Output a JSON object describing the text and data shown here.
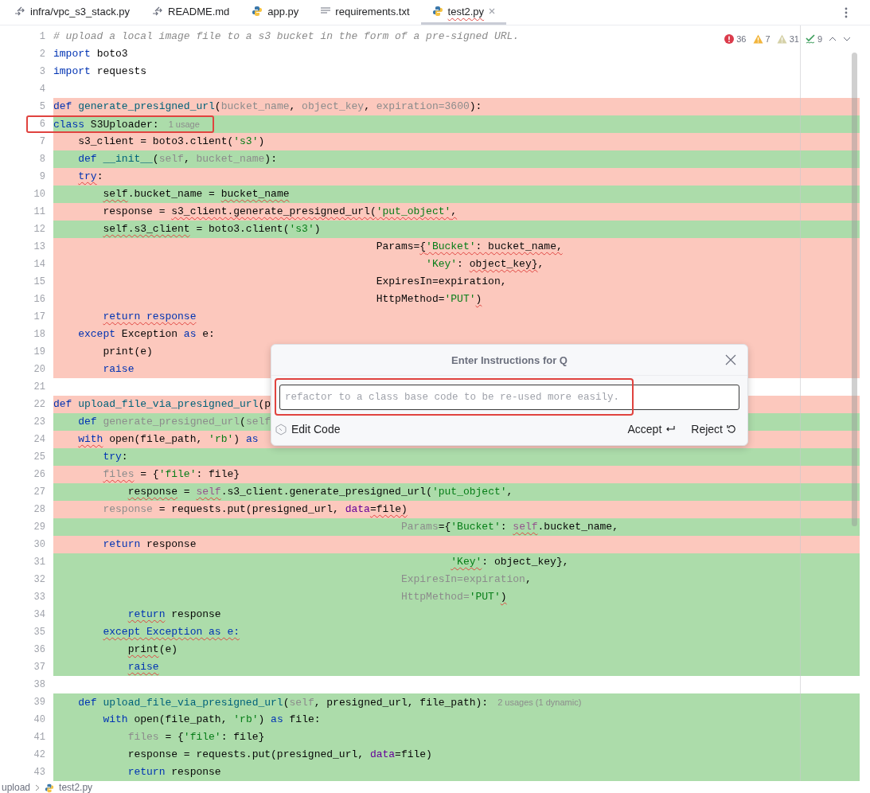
{
  "tabs": [
    {
      "label": "infra/vpc_s3_stack.py",
      "kind": "diff",
      "selected": false
    },
    {
      "label": "README.md",
      "kind": "diff",
      "selected": false
    },
    {
      "label": "app.py",
      "kind": "python",
      "selected": false
    },
    {
      "label": "requirements.txt",
      "kind": "text",
      "selected": false
    },
    {
      "label": "test2.py",
      "kind": "python",
      "selected": true
    }
  ],
  "inspections": [
    {
      "kind": "error",
      "count": "36"
    },
    {
      "kind": "warning",
      "count": "7"
    },
    {
      "kind": "weak",
      "count": "31"
    },
    {
      "kind": "typo",
      "count": "9"
    }
  ],
  "lines": [
    {
      "number": "1",
      "kind": "plain",
      "highlighted": false,
      "code": [
        {
          "kind": "comment",
          "text": "# upload a local image file to a s3 bucket in the form of a pre-signed URL."
        }
      ]
    },
    {
      "number": "2",
      "kind": "plain",
      "highlighted": false,
      "code": [
        {
          "kind": "keyword",
          "text": "import"
        },
        {
          "text": " boto3"
        }
      ]
    },
    {
      "number": "3",
      "kind": "plain",
      "highlighted": false,
      "code": [
        {
          "kind": "keyword",
          "text": "import"
        },
        {
          "text": " requests"
        }
      ]
    },
    {
      "number": "4",
      "kind": "plain",
      "highlighted": false
    },
    {
      "number": "5",
      "kind": "removed",
      "highlighted": false,
      "code": [
        {
          "kind": "keyword",
          "text": "def "
        },
        {
          "kind": "function",
          "text": "generate_presigned_url"
        },
        {
          "text": "("
        },
        {
          "kind": "unused",
          "text": "bucket_name"
        },
        {
          "text": ", "
        },
        {
          "kind": "unused",
          "text": "object_key"
        },
        {
          "text": ", "
        },
        {
          "kind": "unused",
          "text": "expiration=3600"
        },
        {
          "text": "):"
        }
      ]
    },
    {
      "number": "6",
      "kind": "added",
      "highlighted": true,
      "code": [
        {
          "kind": "keyword",
          "text": "class"
        },
        {
          "text": " S3Uploader:"
        },
        {
          "kind": "hint",
          "text": "1 usage"
        }
      ]
    },
    {
      "number": "7",
      "kind": "removed",
      "highlighted": false,
      "code": [
        {
          "text": "    s3_client = boto3.client("
        },
        {
          "kind": "string",
          "text": "'s3'"
        },
        {
          "text": ")"
        }
      ]
    },
    {
      "number": "8",
      "kind": "added",
      "highlighted": false,
      "code": [
        {
          "kind": "keyword",
          "text": "    def "
        },
        {
          "kind": "function",
          "text": "__init__"
        },
        {
          "text": "("
        },
        {
          "kind": "unused",
          "text": "self"
        },
        {
          "text": ", "
        },
        {
          "kind": "unused",
          "text": "bucket_name"
        },
        {
          "text": "):"
        }
      ]
    },
    {
      "number": "9",
      "kind": "removed",
      "highlighted": false,
      "code": [
        {
          "kind": "keyword",
          "text": "    try",
          "squiggle": true
        },
        {
          "text": ":"
        }
      ]
    },
    {
      "number": "10",
      "kind": "added",
      "highlighted": false,
      "code": [
        {
          "text": "        self",
          "squiggle": true
        },
        {
          "text": ".bucket_name = "
        },
        {
          "text": "bucket_name",
          "squiggle": true
        }
      ]
    },
    {
      "number": "11",
      "kind": "removed",
      "highlighted": false,
      "code": [
        {
          "text": "        response = "
        },
        {
          "text": "s3_client.generate_presigned_url(",
          "squiggle": true
        },
        {
          "kind": "string",
          "text": "'put_object'",
          "squiggle": true
        },
        {
          "text": ",",
          "squiggle": true
        }
      ]
    },
    {
      "number": "12",
      "kind": "added",
      "highlighted": false,
      "code": [
        {
          "text": "        self.s3_client",
          "squiggle": true
        },
        {
          "text": " = boto3.client("
        },
        {
          "kind": "string",
          "text": "'s3'"
        },
        {
          "text": ")"
        }
      ]
    },
    {
      "number": "13",
      "kind": "removed",
      "highlighted": false,
      "code": [
        {
          "text": "                                                    Params="
        },
        {
          "text": "{",
          "squiggle": true
        },
        {
          "kind": "string",
          "text": "'Bucket'",
          "squiggle": true
        },
        {
          "text": ": bucket_name,",
          "squiggle": true
        }
      ]
    },
    {
      "number": "14",
      "kind": "removed",
      "highlighted": false,
      "code": [
        {
          "kind": "string",
          "text": "                                                            'Key'"
        },
        {
          "text": ": "
        },
        {
          "text": "object_key}",
          "squiggle": true
        },
        {
          "text": ","
        }
      ]
    },
    {
      "number": "15",
      "kind": "removed",
      "highlighted": false,
      "code": [
        {
          "text": "                                                    ExpiresIn=expiration,"
        }
      ]
    },
    {
      "number": "16",
      "kind": "removed",
      "highlighted": false,
      "code": [
        {
          "text": "                                                    HttpMethod="
        },
        {
          "kind": "string",
          "text": "'PUT'"
        },
        {
          "text": ")",
          "squiggle": true
        }
      ]
    },
    {
      "number": "17",
      "kind": "removed",
      "highlighted": false,
      "code": [
        {
          "kind": "keyword",
          "text": "        return response",
          "squiggle": true
        }
      ]
    },
    {
      "number": "18",
      "kind": "removed",
      "highlighted": false,
      "code": [
        {
          "kind": "keyword",
          "text": "    except"
        },
        {
          "text": " Exception "
        },
        {
          "kind": "keyword",
          "text": "as"
        },
        {
          "text": " e:"
        }
      ]
    },
    {
      "number": "19",
      "kind": "removed",
      "highlighted": false,
      "code": [
        {
          "text": "        print(e)"
        }
      ]
    },
    {
      "number": "20",
      "kind": "removed",
      "highlighted": false,
      "code": [
        {
          "kind": "keyword",
          "text": "        raise"
        }
      ]
    },
    {
      "number": "21",
      "kind": "plain",
      "highlighted": false
    },
    {
      "number": "22",
      "kind": "removed",
      "highlighted": false,
      "code": [
        {
          "kind": "keyword",
          "text": "def "
        },
        {
          "kind": "function",
          "text": "upload_file_via_presigned_url"
        },
        {
          "text": "(p"
        }
      ]
    },
    {
      "number": "23",
      "kind": "added",
      "highlighted": false,
      "code": [
        {
          "kind": "keyword",
          "text": "    def "
        },
        {
          "kind": "unused",
          "text": "generate_presigned_url"
        },
        {
          "text": "("
        },
        {
          "kind": "unused",
          "text": "self"
        }
      ]
    },
    {
      "number": "24",
      "kind": "removed",
      "highlighted": false,
      "code": [
        {
          "kind": "keyword",
          "text": "    with",
          "squiggle": true
        },
        {
          "text": " open(file_path, "
        },
        {
          "kind": "string",
          "text": "'rb'"
        },
        {
          "text": ") "
        },
        {
          "kind": "keyword",
          "text": "as"
        }
      ]
    },
    {
      "number": "25",
      "kind": "added",
      "highlighted": false,
      "code": [
        {
          "kind": "keyword",
          "text": "        try"
        },
        {
          "text": ":"
        }
      ]
    },
    {
      "number": "26",
      "kind": "removed",
      "highlighted": false,
      "code": [
        {
          "kind": "unused",
          "text": "        files",
          "squiggle": true
        },
        {
          "text": " = {"
        },
        {
          "kind": "string",
          "text": "'file'"
        },
        {
          "text": ": file}"
        }
      ]
    },
    {
      "number": "27",
      "kind": "added",
      "highlighted": false,
      "code": [
        {
          "text": "            response",
          "squiggle": true
        },
        {
          "text": " = "
        },
        {
          "kind": "self",
          "text": "self",
          "squiggle": true
        },
        {
          "text": ".s3_client.generate_presigned_url("
        },
        {
          "kind": "string",
          "text": "'put_object'"
        },
        {
          "text": ","
        }
      ]
    },
    {
      "number": "28",
      "kind": "removed",
      "highlighted": false,
      "code": [
        {
          "kind": "unused",
          "text": "        response"
        },
        {
          "text": " = requests.put(presigned_url, "
        },
        {
          "kind": "kwarg",
          "text": "data"
        },
        {
          "text": "=file)",
          "squiggle": true
        }
      ]
    },
    {
      "number": "29",
      "kind": "added",
      "highlighted": false,
      "code": [
        {
          "kind": "unused",
          "text": "                                                        Params"
        },
        {
          "text": "={"
        },
        {
          "kind": "string",
          "text": "'Bucket'"
        },
        {
          "text": ": "
        },
        {
          "kind": "self",
          "text": "self",
          "squiggle": true
        },
        {
          "text": ".bucket_name,"
        }
      ]
    },
    {
      "number": "30",
      "kind": "removed",
      "highlighted": false,
      "code": [
        {
          "kind": "keyword",
          "text": "        return"
        },
        {
          "text": " response"
        }
      ]
    },
    {
      "number": "31",
      "kind": "added",
      "highlighted": false,
      "code": [
        {
          "kind": "string",
          "text": "                                                                'Key'",
          "squiggle": true
        },
        {
          "text": ": object_key},"
        }
      ]
    },
    {
      "number": "32",
      "kind": "added",
      "highlighted": false,
      "code": [
        {
          "kind": "unused",
          "text": "                                                        ExpiresIn=expiration"
        },
        {
          "text": ","
        }
      ]
    },
    {
      "number": "33",
      "kind": "added",
      "highlighted": false,
      "code": [
        {
          "kind": "unused",
          "text": "                                                        HttpMethod="
        },
        {
          "kind": "string",
          "text": "'PUT'"
        },
        {
          "text": ")",
          "squiggle": true
        }
      ]
    },
    {
      "number": "34",
      "kind": "added",
      "highlighted": false,
      "code": [
        {
          "kind": "keyword",
          "text": "            return",
          "squiggle": true
        },
        {
          "text": " response"
        }
      ]
    },
    {
      "number": "35",
      "kind": "added",
      "highlighted": false,
      "code": [
        {
          "kind": "keyword",
          "text": "        except Exception as e:",
          "squiggle": true
        }
      ]
    },
    {
      "number": "36",
      "kind": "added",
      "highlighted": false,
      "code": [
        {
          "text": "            print",
          "squiggle": true
        },
        {
          "text": "(e)"
        }
      ]
    },
    {
      "number": "37",
      "kind": "added",
      "highlighted": false,
      "code": [
        {
          "kind": "keyword",
          "text": "            raise",
          "squiggle": true
        }
      ]
    },
    {
      "number": "38",
      "kind": "plain",
      "highlighted": false
    },
    {
      "number": "39",
      "kind": "added",
      "highlighted": false,
      "code": [
        {
          "kind": "keyword",
          "text": "    def "
        },
        {
          "kind": "function",
          "text": "upload_file_via_presigned_url"
        },
        {
          "text": "("
        },
        {
          "kind": "unused",
          "text": "self"
        },
        {
          "text": ", presigned_url, file_path):"
        },
        {
          "kind": "hint",
          "text": "2 usages (1 dynamic)"
        }
      ]
    },
    {
      "number": "40",
      "kind": "added",
      "highlighted": false,
      "code": [
        {
          "kind": "keyword",
          "text": "        with"
        },
        {
          "text": " open(file_path, "
        },
        {
          "kind": "string",
          "text": "'rb'"
        },
        {
          "text": ") "
        },
        {
          "kind": "keyword",
          "text": "as"
        },
        {
          "text": " file:"
        }
      ]
    },
    {
      "number": "41",
      "kind": "added",
      "highlighted": false,
      "code": [
        {
          "kind": "unused",
          "text": "            files"
        },
        {
          "text": " = {"
        },
        {
          "kind": "string",
          "text": "'file'"
        },
        {
          "text": ": file}"
        }
      ]
    },
    {
      "number": "42",
      "kind": "added",
      "highlighted": false,
      "code": [
        {
          "text": "            response = requests.put(presigned_url, "
        },
        {
          "kind": "kwarg",
          "text": "data"
        },
        {
          "text": "=file)"
        }
      ]
    },
    {
      "number": "43",
      "kind": "added",
      "highlighted": false,
      "code": [
        {
          "kind": "keyword",
          "text": "            return"
        },
        {
          "text": " response"
        }
      ]
    }
  ],
  "dialog": {
    "title": "Enter Instructions for Q",
    "input": {
      "placeholder": "refactor to a class base code to be re-used more easily.",
      "highlighted": true
    },
    "mode": "Edit Code",
    "buttons": [
      "Accept",
      "Reject"
    ]
  },
  "breadcrumbs": [
    "upload",
    "test2.py"
  ]
}
